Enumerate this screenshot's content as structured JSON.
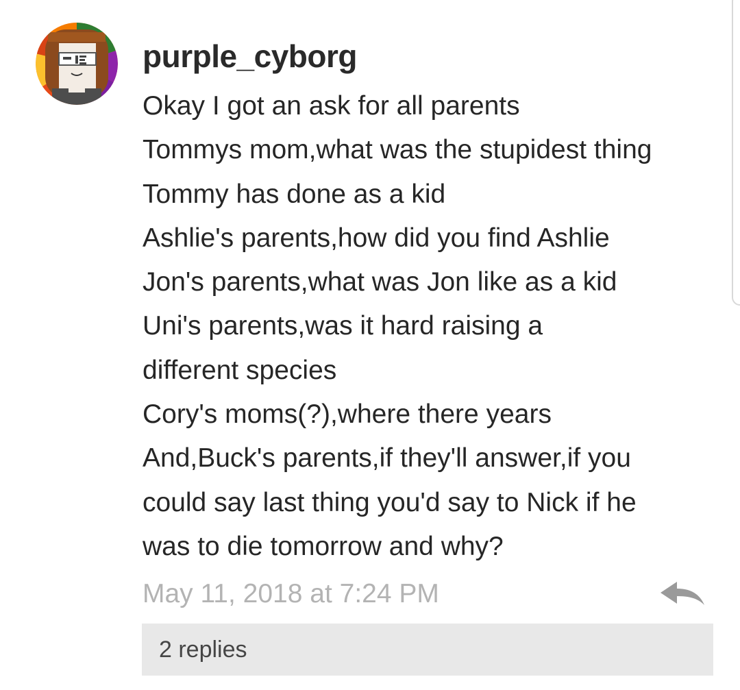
{
  "comment": {
    "username": "purple_cyborg",
    "avatar_icon": "pixel-art-avatar-icon",
    "lines": [
      "Okay I got an ask for all parents",
      "Tommys mom,what was the stupidest thing",
      "Tommy has done as a kid",
      "Ashlie's parents,how did you find Ashlie",
      "Jon's parents,what was Jon like as a kid",
      "Uni's parents,was it hard raising a",
      "different species",
      "Cory's moms(?),where there years",
      "And,Buck's parents,if they'll answer,if you",
      "could say last thing you'd say to Nick if he",
      "was to die tomorrow and why?"
    ],
    "timestamp": "May 11, 2018 at 7:24 PM",
    "reply_icon": "reply-arrow-icon",
    "replies_label": "2 replies"
  },
  "colors": {
    "username": "#2a2a2a",
    "body_text": "#262626",
    "timestamp": "#b3b3b3",
    "reply_icon": "#9a9a9a",
    "replies_bar_bg": "#e8e8e8",
    "replies_text": "#454545"
  }
}
